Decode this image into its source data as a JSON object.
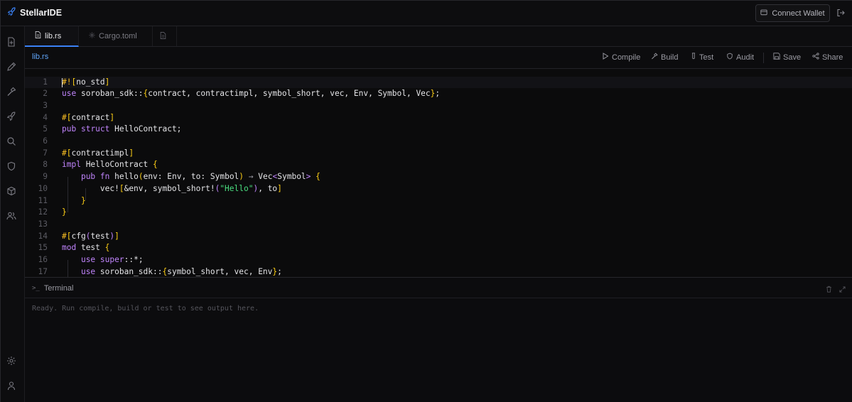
{
  "app": {
    "name": "StellarIDE",
    "accent": "#3b82f6",
    "brand_icon": "rocket-icon"
  },
  "header": {
    "connect_wallet_label": "Connect Wallet",
    "wallet_icon": "wallet-icon",
    "logout_icon": "logout-icon"
  },
  "activity_bar": {
    "items": [
      "new-file-icon",
      "pencil-icon",
      "hammer-icon",
      "rocket-icon",
      "search-icon",
      "shield-icon",
      "package-icon",
      "users-icon"
    ],
    "bottom": [
      "settings-icon",
      "user-icon"
    ]
  },
  "tabs": [
    {
      "label": "lib.rs",
      "icon": "file-icon",
      "active": true
    },
    {
      "label": "Cargo.toml",
      "icon": "gear-icon",
      "active": false
    },
    {
      "label": "",
      "icon": "file-icon",
      "active": false
    }
  ],
  "toolbar": {
    "current_file": "lib.rs",
    "actions": [
      {
        "label": "Compile",
        "icon": "play-icon"
      },
      {
        "label": "Build",
        "icon": "hammer-icon"
      },
      {
        "label": "Test",
        "icon": "test-tube-icon"
      },
      {
        "label": "Audit",
        "icon": "shield-icon"
      },
      {
        "label": "Save",
        "icon": "save-icon"
      },
      {
        "label": "Share",
        "icon": "share-icon"
      }
    ]
  },
  "editor": {
    "current_line": 1,
    "lines": [
      {
        "n": "1",
        "text": "#![no_std]"
      },
      {
        "n": "2",
        "text": "use soroban_sdk::{contract, contractimpl, symbol_short, vec, Env, Symbol, Vec};"
      },
      {
        "n": "3",
        "text": ""
      },
      {
        "n": "4",
        "text": "#[contract]"
      },
      {
        "n": "5",
        "text": "pub struct HelloContract;"
      },
      {
        "n": "6",
        "text": ""
      },
      {
        "n": "7",
        "text": "#[contractimpl]"
      },
      {
        "n": "8",
        "text": "impl HelloContract {"
      },
      {
        "n": "9",
        "text": "    pub fn hello(env: Env, to: Symbol) → Vec<Symbol> {"
      },
      {
        "n": "10",
        "text": "        vec![&env, symbol_short!(\"Hello\"), to]"
      },
      {
        "n": "11",
        "text": "    }"
      },
      {
        "n": "12",
        "text": "}"
      },
      {
        "n": "13",
        "text": ""
      },
      {
        "n": "14",
        "text": "#[cfg(test)]"
      },
      {
        "n": "15",
        "text": "mod test {"
      },
      {
        "n": "16",
        "text": "    use super::*;"
      },
      {
        "n": "17",
        "text": "    use soroban_sdk::{symbol_short, vec, Env};"
      }
    ]
  },
  "terminal": {
    "title": "Terminal",
    "prompt_glyph": ">_",
    "output": "Ready. Run compile, build or test to see output here.",
    "clear_icon": "trash-icon",
    "maximize_icon": "maximize-icon"
  }
}
